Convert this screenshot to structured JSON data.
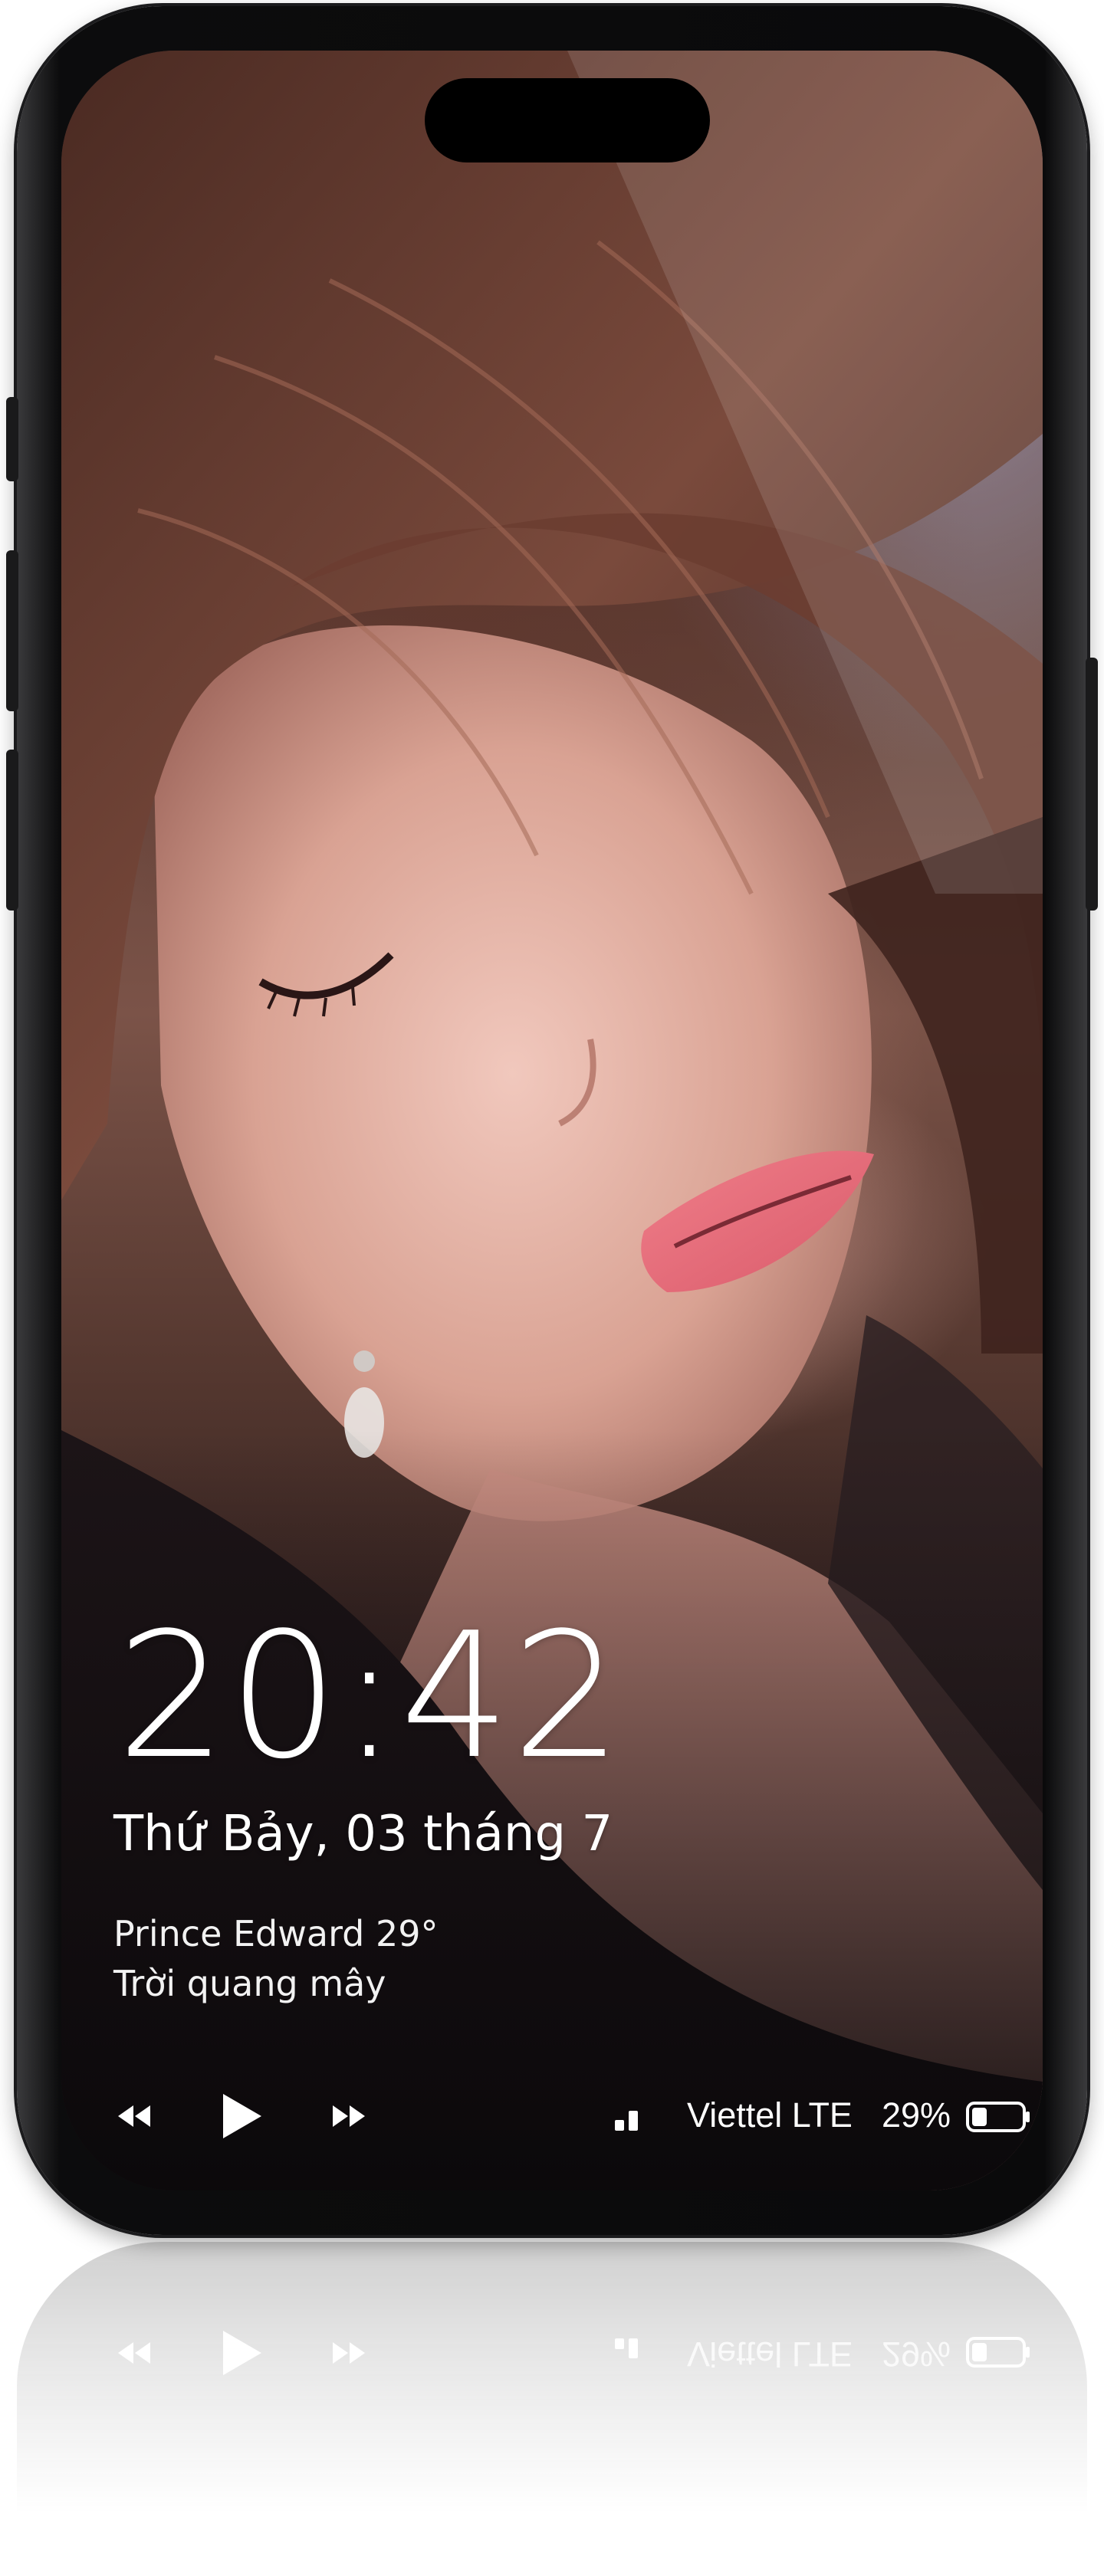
{
  "lock_screen": {
    "time": "20:42",
    "date": "Thứ Bảy, 03 tháng 7",
    "weather": {
      "location_temp": "Prince Edward 29°",
      "condition": "Trời quang mây"
    },
    "media_controls": {
      "previous_icon": "rewind-icon",
      "play_icon": "play-icon",
      "next_icon": "fast-forward-icon"
    },
    "status": {
      "signal_icon": "signal-bars-icon",
      "carrier": "Viettel LTE",
      "battery_percent": "29%",
      "battery_level": 0.29,
      "battery_icon": "battery-icon"
    }
  },
  "colors": {
    "text": "#ffffff",
    "frame": "#0a0a0b",
    "island": "#000000"
  }
}
